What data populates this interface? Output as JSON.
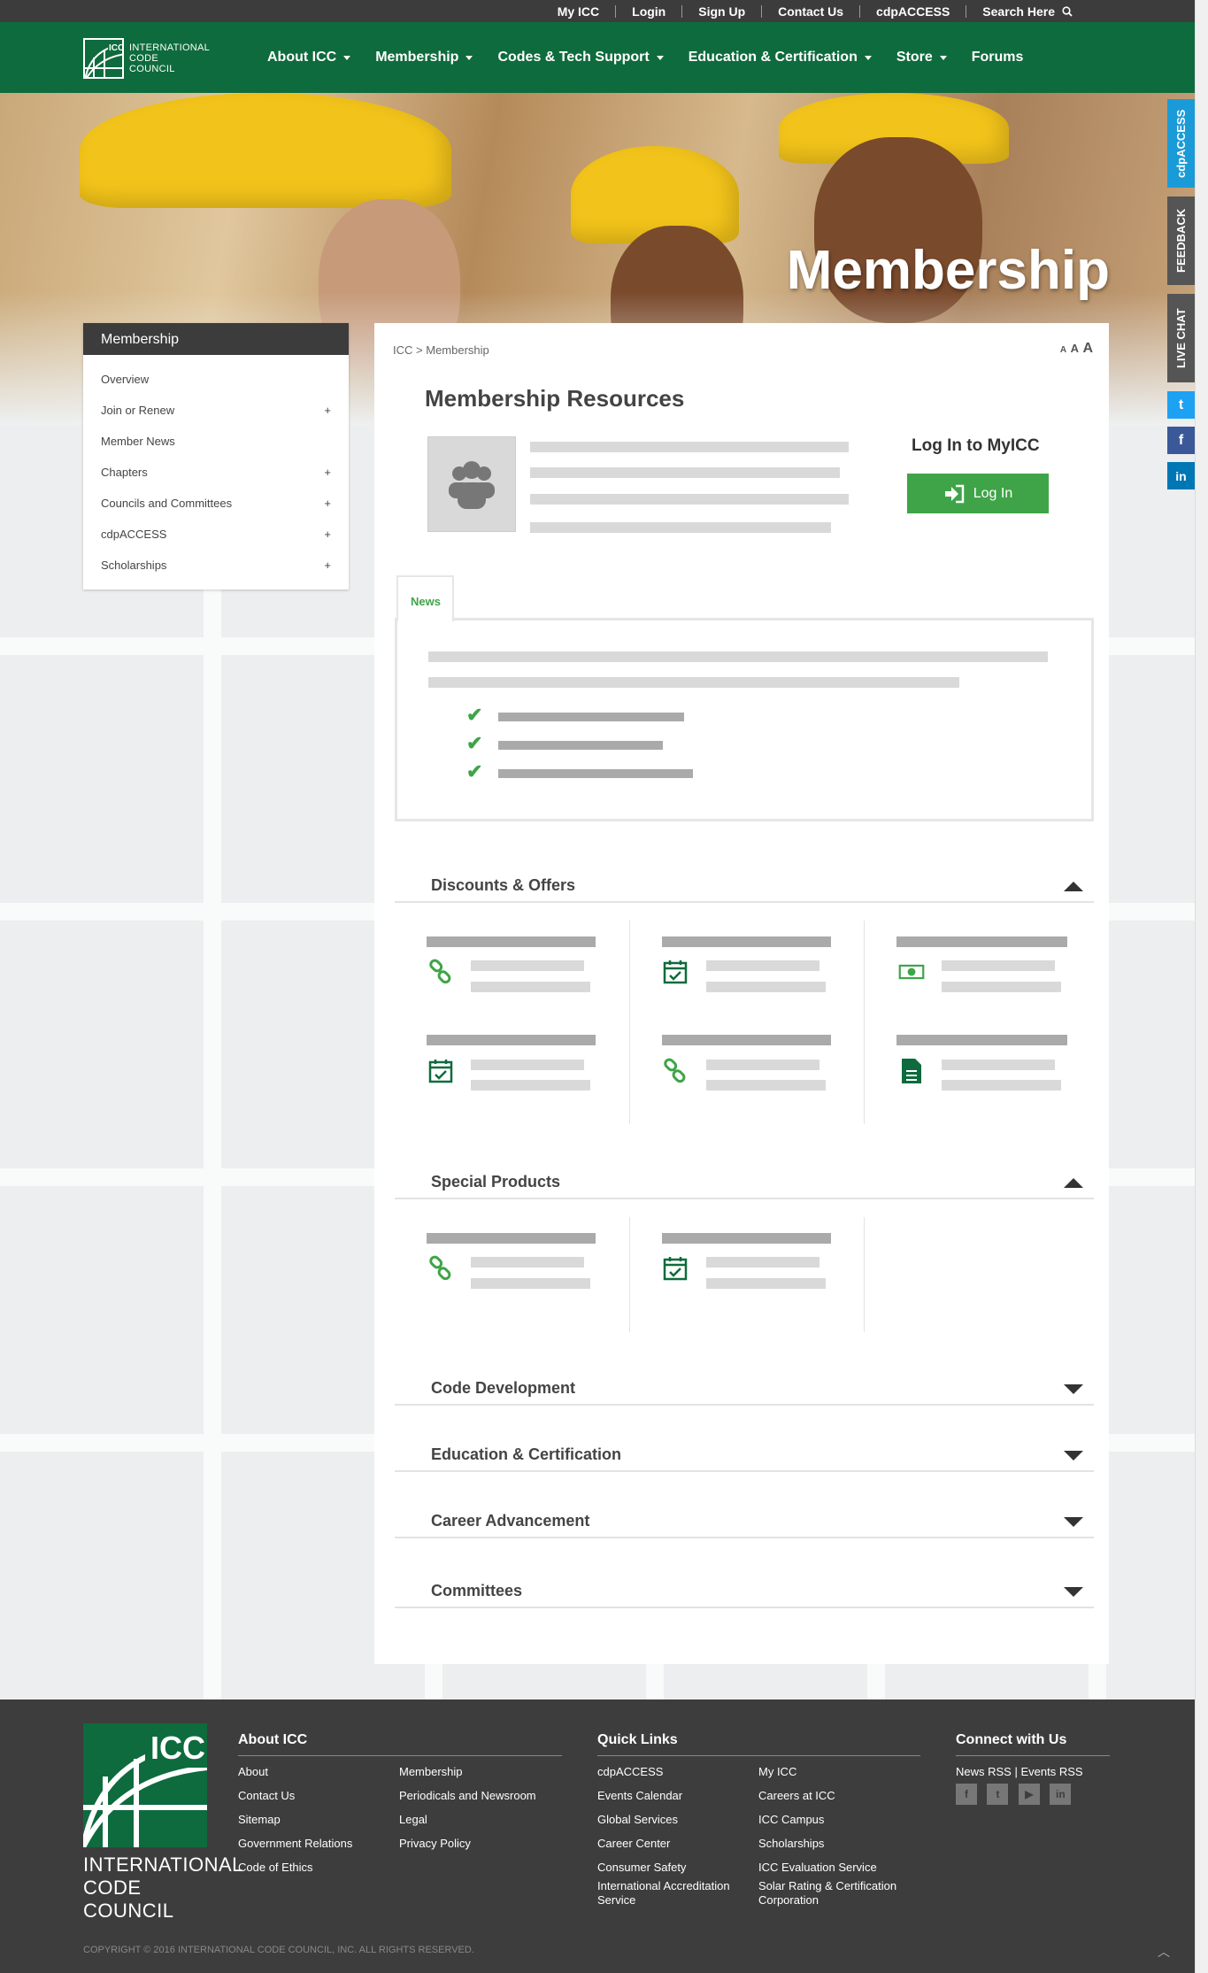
{
  "topbar": {
    "links": [
      "My ICC",
      "Login",
      "Sign Up",
      "Contact Us",
      "cdpACCESS"
    ],
    "search_label": "Search Here"
  },
  "logo": {
    "line1": "ICC",
    "line2": "INTERNATIONAL",
    "line3": "CODE",
    "line4": "COUNCIL"
  },
  "nav": {
    "items": [
      {
        "label": "About ICC"
      },
      {
        "label": "Membership"
      },
      {
        "label": "Codes & Tech Support"
      },
      {
        "label": "Education & Certification"
      },
      {
        "label": "Store"
      },
      {
        "label": "Forums"
      }
    ]
  },
  "hero": {
    "title": "Membership"
  },
  "side_tabs": {
    "cdp": "cdpACCESS",
    "feedback": "FEEDBACK",
    "chat": "LIVE CHAT"
  },
  "sidebar": {
    "title": "Membership",
    "items": [
      {
        "label": "Overview",
        "plus": ""
      },
      {
        "label": "Join or Renew",
        "plus": "+"
      },
      {
        "label": "Member News",
        "plus": ""
      },
      {
        "label": "Chapters",
        "plus": "+"
      },
      {
        "label": "Councils and Committees",
        "plus": "+"
      },
      {
        "label": "cdpACCESS",
        "plus": "+"
      },
      {
        "label": "Scholarships",
        "plus": "+"
      }
    ]
  },
  "main": {
    "breadcrumb_root": "ICC",
    "breadcrumb_sep": ">",
    "breadcrumb_current": "Membership",
    "font_sizes": [
      "A",
      "A",
      "A"
    ],
    "title": "Membership Resources",
    "login_heading": "Log In to MyICC",
    "login_button": "Log In",
    "news_tab": "News",
    "sections": [
      {
        "title": "Discounts & Offers",
        "state": "expanded"
      },
      {
        "title": "Special Products",
        "state": "expanded"
      },
      {
        "title": "Code Development",
        "state": "collapsed"
      },
      {
        "title": "Education & Certification",
        "state": "collapsed"
      },
      {
        "title": "Career Advancement",
        "state": "collapsed"
      },
      {
        "title": "Committees",
        "state": "collapsed"
      }
    ]
  },
  "footer": {
    "logo_top": "ICC",
    "logo_line1": "INTERNATIONAL",
    "logo_line2": "CODE COUNCIL",
    "about": {
      "heading": "About ICC",
      "col1": [
        "About",
        "Contact Us",
        "Sitemap",
        "Government Relations",
        "Code of Ethics"
      ],
      "col2": [
        "Membership",
        "Periodicals and Newsroom",
        "Legal",
        "Privacy Policy"
      ]
    },
    "quick": {
      "heading": "Quick Links",
      "col1": [
        "cdpACCESS",
        "Events Calendar",
        "Global Services",
        "Career Center",
        "Consumer Safety",
        "International Accreditation Service"
      ],
      "col2": [
        "My ICC",
        "Careers at ICC",
        "ICC Campus",
        "Scholarships",
        "ICC Evaluation Service",
        "Solar Rating & Certification Corporation"
      ]
    },
    "connect": {
      "heading": "Connect with Us",
      "news_rss": "News RSS",
      "sep": "|",
      "events_rss": "Events RSS"
    },
    "copyright": "COPYRIGHT © 2016 INTERNATIONAL CODE COUNCIL, INC. ALL RIGHTS RESERVED."
  },
  "colors": {
    "brand_green": "#0e6b3d",
    "accent_green": "#3fa447",
    "dark": "#3d3d3d",
    "cdp_blue": "#1a9bd7",
    "twitter": "#1da1f2",
    "facebook": "#3b5998",
    "linkedin": "#0077b5"
  }
}
